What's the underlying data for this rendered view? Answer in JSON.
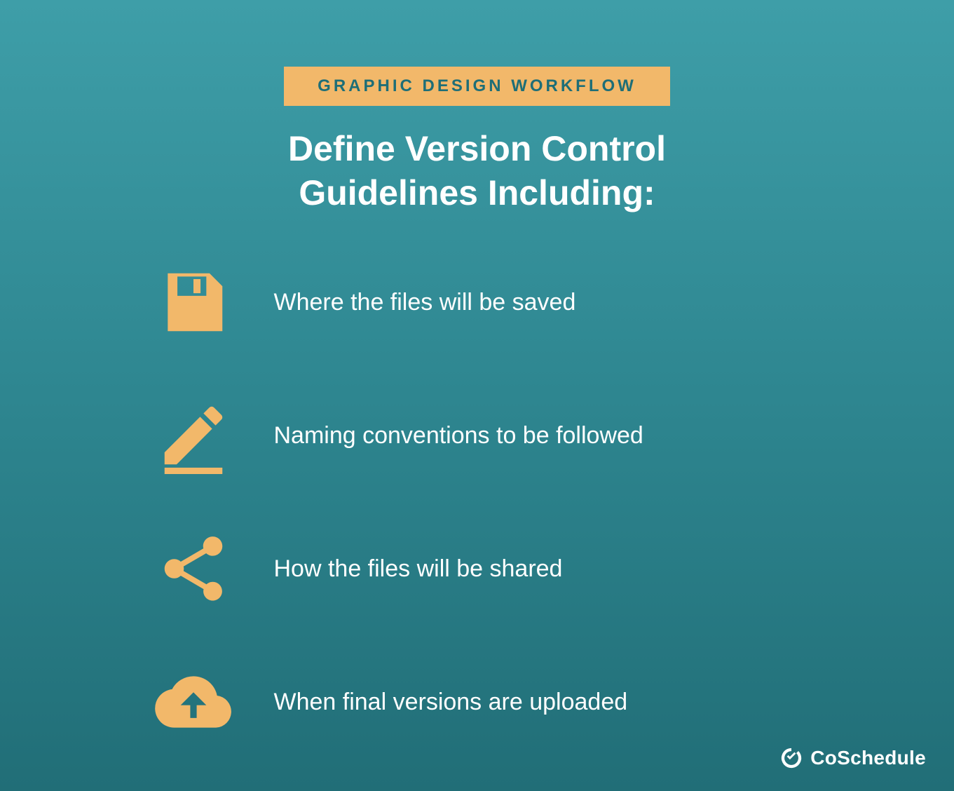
{
  "badge": "GRAPHIC DESIGN WORKFLOW",
  "headline": "Define Version Control Guidelines Including:",
  "items": [
    {
      "icon": "save-icon",
      "text": "Where the files will be saved"
    },
    {
      "icon": "pencil-icon",
      "text": "Naming conventions to be followed"
    },
    {
      "icon": "share-icon",
      "text": "How the files will be shared"
    },
    {
      "icon": "cloud-upload-icon",
      "text": "When final versions are uploaded"
    }
  ],
  "brand": "CoSchedule",
  "colors": {
    "accent": "#f2b86a",
    "text": "#ffffff"
  }
}
